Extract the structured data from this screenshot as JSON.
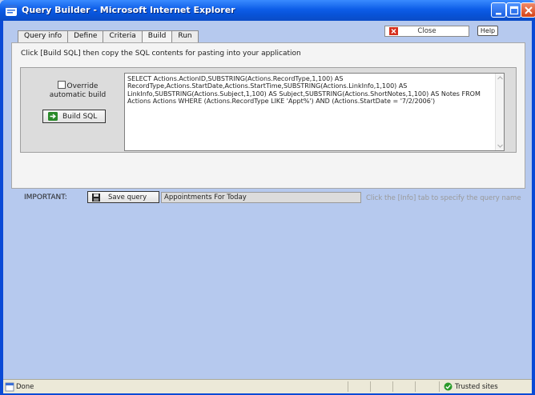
{
  "window": {
    "title": "Query Builder - Microsoft Internet Explorer",
    "controls": [
      "minimize-icon",
      "maximize-icon",
      "close-icon"
    ]
  },
  "tabs": [
    {
      "label": "Query info"
    },
    {
      "label": "Define"
    },
    {
      "label": "Criteria"
    },
    {
      "label": "Build",
      "active": true
    },
    {
      "label": "Run"
    }
  ],
  "toolbar": {
    "close_label": "Close",
    "help_label": "Help"
  },
  "build": {
    "instruction": "Click [Build SQL] then copy the SQL contents for pasting into your application",
    "override_label": "Override automatic build",
    "override_checked": false,
    "build_sql_label": "Build SQL",
    "sql_text": "SELECT Actions.ActionID,SUBSTRING(Actions.RecordType,1,100) AS RecordType,Actions.StartDate,Actions.StartTime,SUBSTRING(Actions.LinkInfo,1,100) AS LinkInfo,SUBSTRING(Actions.Subject,1,100) AS Subject,SUBSTRING(Actions.ShortNotes,1,100) AS Notes FROM Actions Actions WHERE (Actions.RecordType LIKE 'Appt%') AND (Actions.StartDate = '7/2/2006')"
  },
  "save": {
    "important_label": "IMPORTANT:",
    "save_query_label": "Save query",
    "query_name": "Appointments For Today",
    "hint": "Click the [Info] tab to specify the query name"
  },
  "status": {
    "text": "Done",
    "zone": "Trusted sites"
  },
  "colors": {
    "titlebar": "#0a4ad6",
    "background": "#b6c9ee",
    "panel": "#f4f4f4",
    "close_icon_red": "#d6301e",
    "build_arrow_green": "#2a8a2a"
  }
}
